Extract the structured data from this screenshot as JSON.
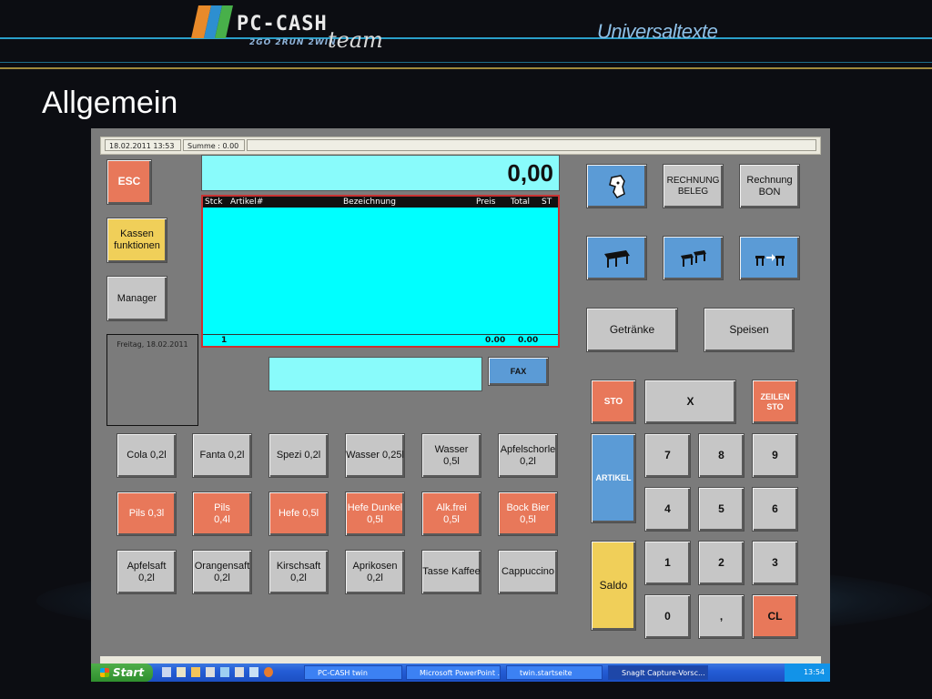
{
  "slide": {
    "logo_text": "PC-CASH",
    "logo_sub": "2GO 2RUN 2WIN",
    "logo_team": "team",
    "subtitle": "Universaltexte",
    "title": "Allgemein"
  },
  "status_bar": {
    "datetime": "18.02.2011 13:53",
    "sum": "Summe : 0.00"
  },
  "left_buttons": {
    "esc": "ESC",
    "kassen": "Kassen\nfunktionen",
    "manager": "Manager"
  },
  "date_panel": "Freitag, 18.02.2011",
  "display": {
    "amount": "0,00"
  },
  "receipt": {
    "headers": [
      "Stck",
      "Artikel#",
      "Bezeichnung",
      "Preis",
      "Total",
      "ST"
    ],
    "footer_qty": "1",
    "footer_price": "0.00",
    "footer_total": "0.00"
  },
  "fax_label": "FAX",
  "right_buttons": {
    "rechnung_beleg": "RECHNUNG\nBELEG",
    "rechnung_bon": "Rechnung\nBON",
    "getraenke": "Getränke",
    "speisen": "Speisen"
  },
  "products": [
    {
      "label": "Cola 0,2l",
      "color": "gray"
    },
    {
      "label": "Fanta 0,2l",
      "color": "gray"
    },
    {
      "label": "Spezi 0,2l",
      "color": "gray"
    },
    {
      "label": "Wasser 0,25l",
      "color": "gray"
    },
    {
      "label": "Wasser\n0,5l",
      "color": "gray"
    },
    {
      "label": "Apfelschorle\n0,2l",
      "color": "gray"
    },
    {
      "label": "Pils 0,3l",
      "color": "orange"
    },
    {
      "label": "Pils\n0,4l",
      "color": "orange"
    },
    {
      "label": "Hefe 0,5l",
      "color": "orange"
    },
    {
      "label": "Hefe Dunkel\n0,5l",
      "color": "orange"
    },
    {
      "label": "Alk.frei\n0,5l",
      "color": "orange"
    },
    {
      "label": "Bock Bier\n0,5l",
      "color": "orange"
    },
    {
      "label": "Apfelsaft\n0,2l",
      "color": "gray"
    },
    {
      "label": "Orangensaft\n0,2l",
      "color": "gray"
    },
    {
      "label": "Kirschsaft\n0,2l",
      "color": "gray"
    },
    {
      "label": "Aprikosen\n0,2l",
      "color": "gray"
    },
    {
      "label": "Tasse Kaffee",
      "color": "gray"
    },
    {
      "label": "Cappuccino",
      "color": "gray"
    }
  ],
  "keypad": {
    "sto": "STO",
    "x": "X",
    "zeilen_sto": "ZEILEN\nSTO",
    "artikel": "ARTIKEL",
    "saldo": "Saldo",
    "k7": "7",
    "k8": "8",
    "k9": "9",
    "k4": "4",
    "k5": "5",
    "k6": "6",
    "k1": "1",
    "k2": "2",
    "k3": "3",
    "k0": "0",
    "comma": ",",
    "cl": "CL"
  },
  "taskbar": {
    "start": "Start",
    "items": [
      "PC-CASH twin",
      "Microsoft PowerPoint ...",
      "twin.startseite",
      "SnagIt Capture-Vorsc..."
    ],
    "clock": "13:54"
  },
  "colors": {
    "orange": "#e8785a",
    "yellow": "#f0cf59",
    "blue": "#5b9bd6",
    "cyan_display": "#00ffff"
  }
}
